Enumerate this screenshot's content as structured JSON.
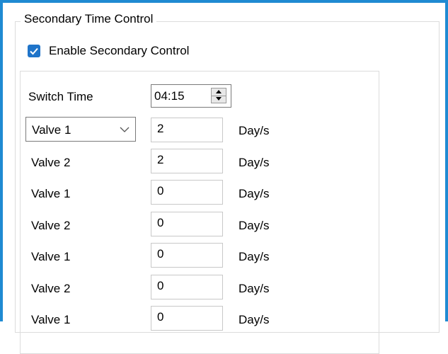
{
  "group": {
    "title": "Secondary Time Control",
    "enable_label": "Enable Secondary Control",
    "enable_checked": true
  },
  "switch_time": {
    "label": "Switch Time",
    "value": "04:15"
  },
  "rows": [
    {
      "valve": "Valve 1",
      "value": "2",
      "unit": "Day/s",
      "is_dropdown": true
    },
    {
      "valve": "Valve 2",
      "value": "2",
      "unit": "Day/s"
    },
    {
      "valve": "Valve 1",
      "value": "0",
      "unit": "Day/s"
    },
    {
      "valve": "Valve 2",
      "value": "0",
      "unit": "Day/s"
    },
    {
      "valve": "Valve 1",
      "value": "0",
      "unit": "Day/s"
    },
    {
      "valve": "Valve 2",
      "value": "0",
      "unit": "Day/s"
    },
    {
      "valve": "Valve 1",
      "value": "0",
      "unit": "Day/s"
    }
  ],
  "colors": {
    "accent": "#1f74c9",
    "frame": "#1f8ad2"
  }
}
